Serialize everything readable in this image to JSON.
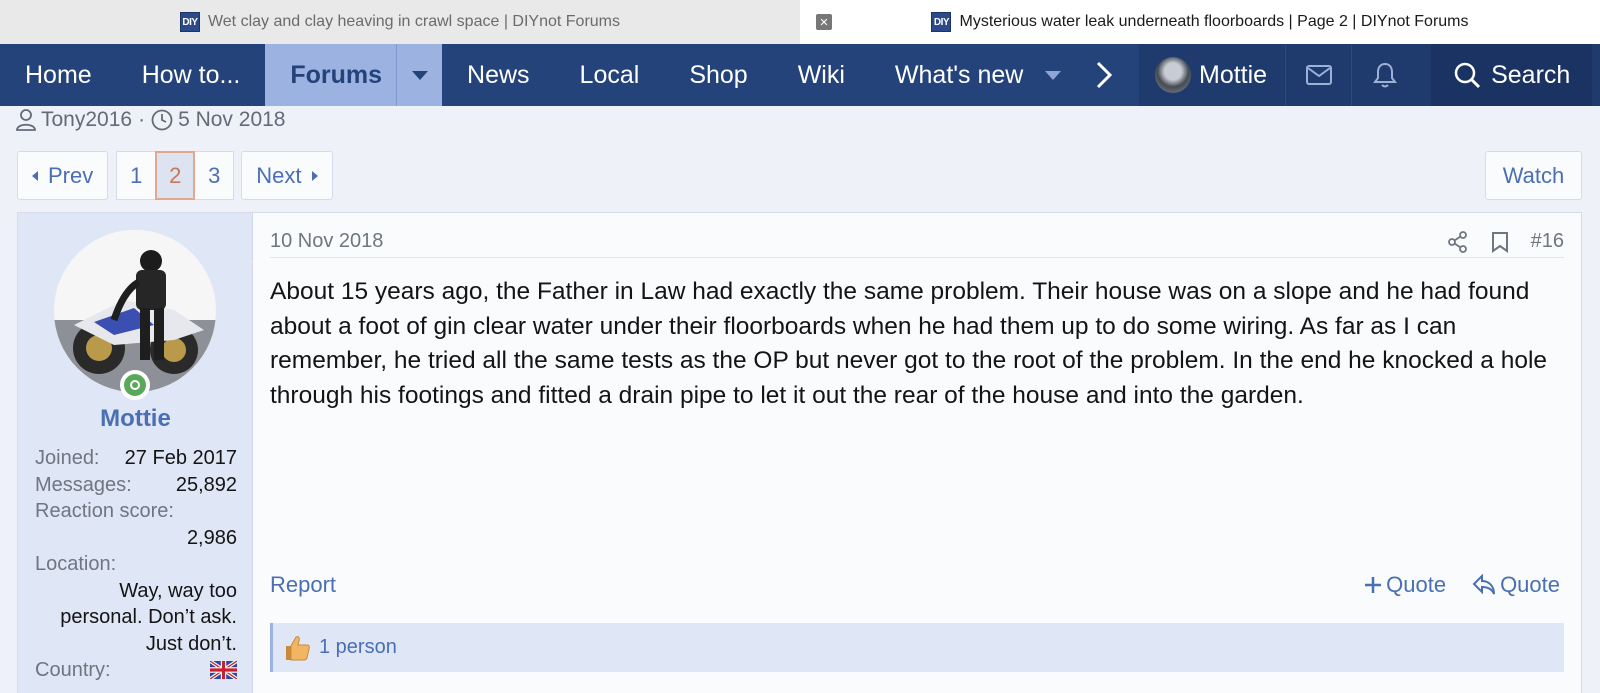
{
  "tabs": [
    {
      "title": "Wet clay and clay heaving in crawl space | DIYnot Forums",
      "favicon": "DIY",
      "active": false
    },
    {
      "title": "Mysterious water leak underneath floorboards | Page 2 | DIYnot Forums",
      "favicon": "DIY",
      "active": true
    }
  ],
  "nav": {
    "items": [
      "Home",
      "How to...",
      "Forums",
      "News",
      "Local",
      "Shop",
      "Wiki",
      "What's new"
    ],
    "username": "Mottie",
    "search_label": "Search"
  },
  "thread": {
    "author": "Tony2016",
    "separator": "·",
    "date": "5 Nov 2018"
  },
  "pager": {
    "prev": "Prev",
    "pages": [
      "1",
      "2",
      "3"
    ],
    "current": "2",
    "next": "Next",
    "watch": "Watch"
  },
  "post": {
    "user": {
      "name": "Mottie",
      "joined_label": "Joined:",
      "joined": "27 Feb 2017",
      "messages_label": "Messages:",
      "messages": "25,892",
      "reaction_label": "Reaction score:",
      "reaction": "2,986",
      "location_label": "Location:",
      "location": "Way, way too personal. Don’t ask. Just don’t.",
      "country_label": "Country:",
      "country_flag": "united-kingdom-flag-icon"
    },
    "date": "10 Nov 2018",
    "number": "#16",
    "body": "About 15 years ago, the Father in Law had exactly the same problem. Their house was on a slope and he had found about a foot of gin clear water under their floorboards when he had them up to do some wiring. As far as I can remember, he tried all the same tests as the OP but never got to the root of the problem. In the end he knocked a hole through his footings and fitted a drain pipe to let it out the rear of the house and into the garden.",
    "report": "Report",
    "quote_multi": "Quote",
    "quote_reply": "Quote",
    "reactions": "1 person"
  },
  "colors": {
    "nav_bg": "#24437b",
    "nav_active": "#9cb2e1",
    "link": "#4a6fb3",
    "online": "#5aa85a"
  }
}
